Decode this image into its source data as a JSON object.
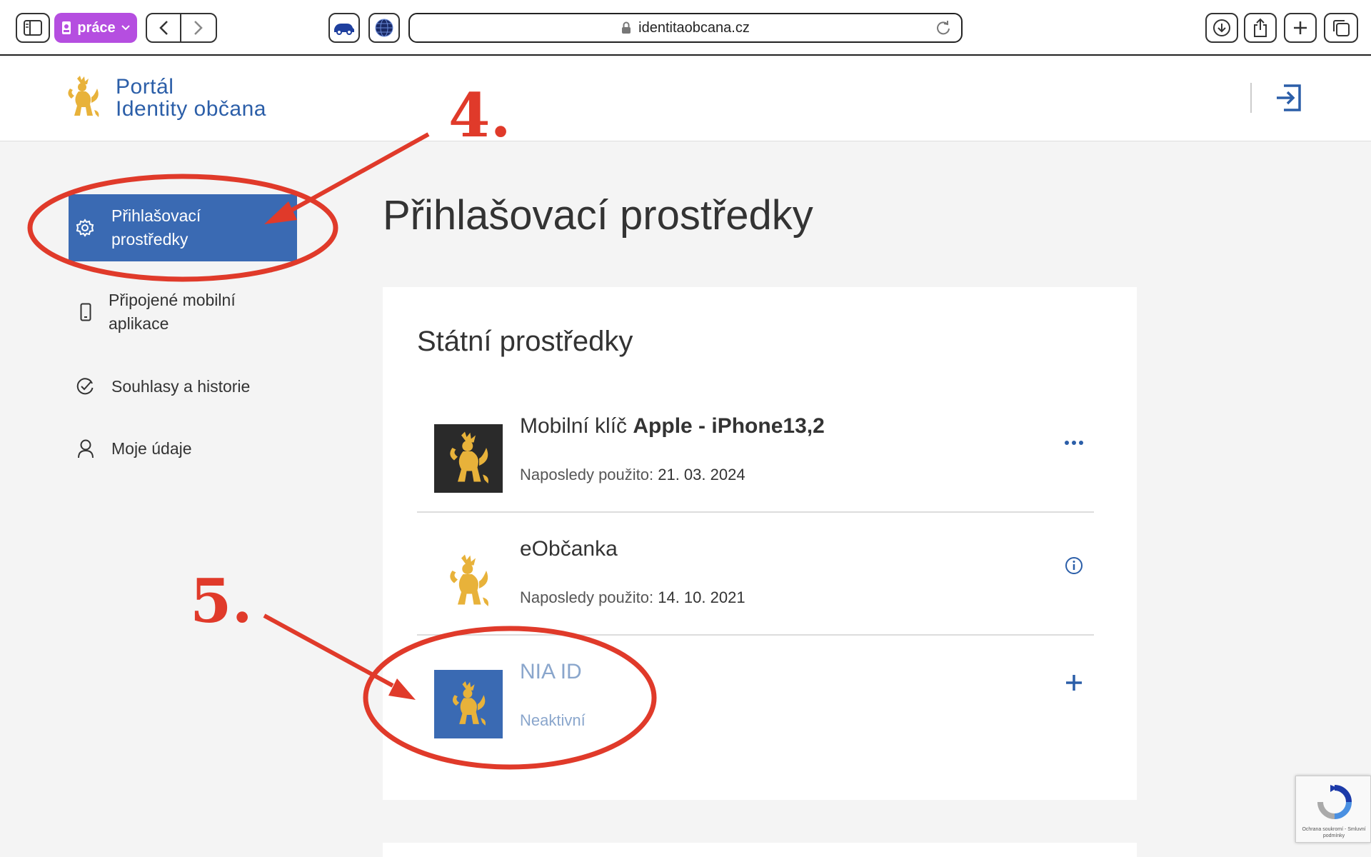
{
  "browser": {
    "profile_label": "práce",
    "url": "identitaobcana.cz"
  },
  "header": {
    "brand_line1": "Portál",
    "brand_line2": "Identity občana"
  },
  "sidebar": {
    "items": [
      {
        "label_line1": "Přihlašovací",
        "label_line2": "prostředky",
        "icon": "gear-icon",
        "active": true
      },
      {
        "label_line1": "Připojené mobilní",
        "label_line2": "aplikace",
        "icon": "phone-icon",
        "active": false
      },
      {
        "label": "Souhlasy a historie",
        "icon": "check-circle-icon",
        "active": false
      },
      {
        "label": "Moje údaje",
        "icon": "user-icon",
        "active": false
      }
    ]
  },
  "main": {
    "title": "Přihlašovací prostředky",
    "section_title": "Státní prostředky",
    "items": [
      {
        "name_prefix": "Mobilní klíč ",
        "name_bold": "Apple - iPhone13,2",
        "sub_label": "Naposledy použito: ",
        "sub_value": "21. 03. 2024",
        "action_icon": "more-icon"
      },
      {
        "name": "eObčanka",
        "sub_label": "Naposledy použito: ",
        "sub_value": "14. 10. 2021",
        "action_icon": "info-icon"
      },
      {
        "name": "NIA ID",
        "sub": "Neaktivní",
        "action_icon": "plus-icon"
      }
    ]
  },
  "annotations": {
    "step_4": "4.",
    "step_5": "5."
  },
  "recaptcha": {
    "text": "Ochrana soukromí - Smluvní podmínky"
  },
  "colors": {
    "accent": "#3a6ab3",
    "brand_text": "#2b5ea8",
    "annotation": "#e03a2a",
    "lion_gold": "#e8b23a"
  }
}
